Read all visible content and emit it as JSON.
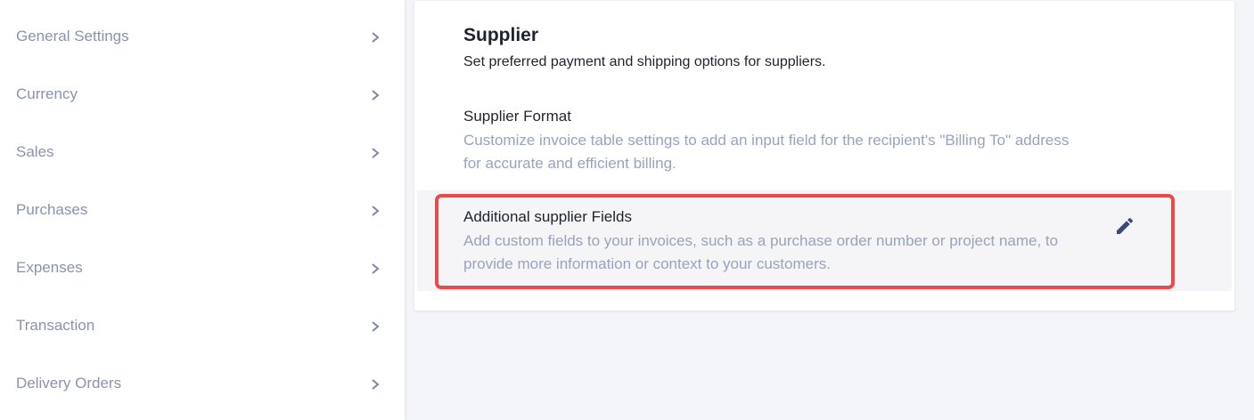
{
  "sidebar": {
    "items": [
      {
        "label": "General Settings",
        "icon": "chevron-right-icon"
      },
      {
        "label": "Currency",
        "icon": "chevron-right-icon"
      },
      {
        "label": "Sales",
        "icon": "chevron-right-icon"
      },
      {
        "label": "Purchases",
        "icon": "chevron-right-icon"
      },
      {
        "label": "Expenses",
        "icon": "chevron-right-icon"
      },
      {
        "label": "Transaction",
        "icon": "chevron-right-icon"
      },
      {
        "label": "Delivery Orders",
        "icon": "chevron-right-icon"
      }
    ]
  },
  "main": {
    "title": "Supplier",
    "subtitle": "Set preferred payment and shipping options for suppliers.",
    "settings": [
      {
        "title": "Supplier Format",
        "description": "Customize invoice table settings to add an input field for the recipient's \"Billing To\" address for accurate and efficient billing."
      },
      {
        "title": "Additional supplier Fields",
        "description": "Add custom fields to your invoices, such as a purchase order number or project name, to provide more information or context to your customers.",
        "action_icon": "pencil-icon",
        "highlighted": true
      }
    ]
  },
  "colors": {
    "highlight_border": "#ea4a4a",
    "sidebar_text": "#8a93ad",
    "description_text": "#98a3be",
    "edit_icon": "#3b4a7a"
  }
}
